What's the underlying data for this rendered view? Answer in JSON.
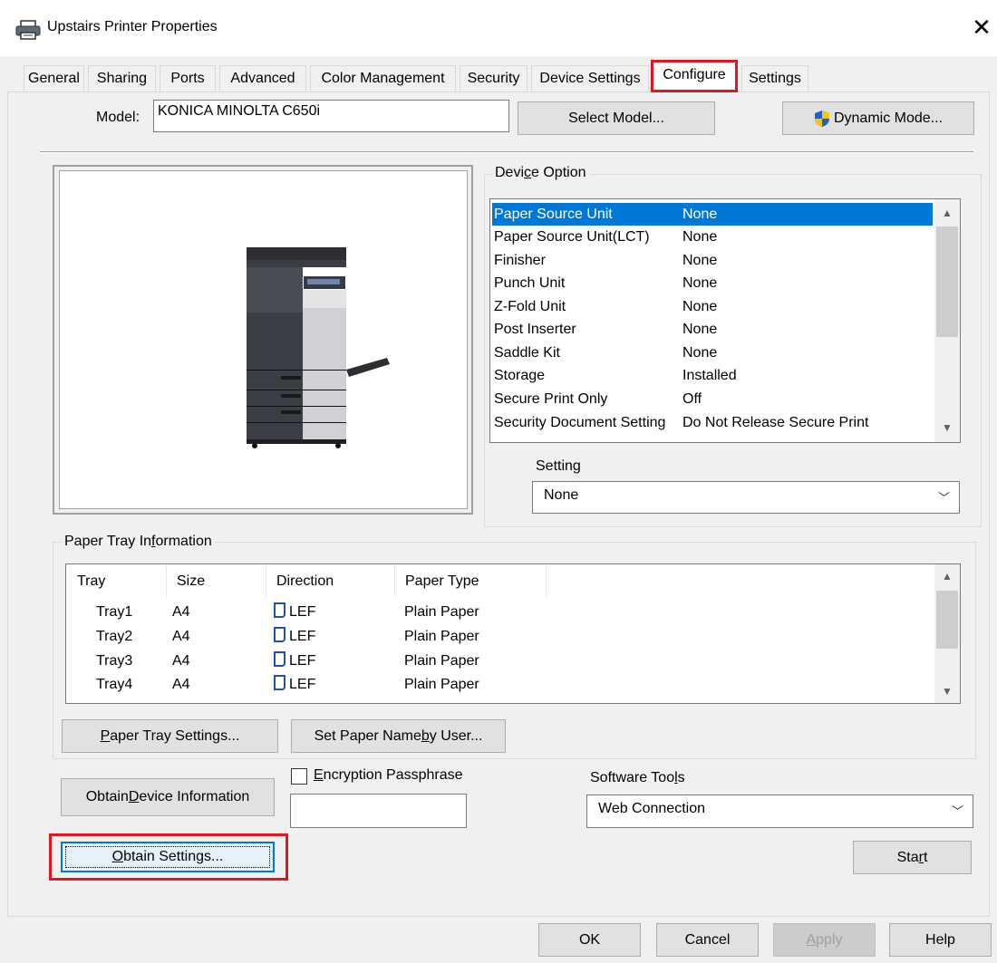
{
  "window": {
    "title": "Upstairs Printer Properties",
    "close": "✕"
  },
  "tabs": [
    "General",
    "Sharing",
    "Ports",
    "Advanced",
    "Color Management",
    "Security",
    "Device Settings",
    "Configure",
    "Settings"
  ],
  "model": {
    "label": "Model:",
    "value": "KONICA MINOLTA C650i",
    "select_button": "Select Model...",
    "dynamic_button": "Dynamic Mode..."
  },
  "device_option": {
    "title_pre": "Devi",
    "title_u": "c",
    "title_post": "e Option",
    "rows": [
      {
        "name": "Paper Source Unit",
        "value": "None"
      },
      {
        "name": "Paper Source Unit(LCT)",
        "value": "None"
      },
      {
        "name": "Finisher",
        "value": "None"
      },
      {
        "name": "Punch Unit",
        "value": "None"
      },
      {
        "name": "Z-Fold Unit",
        "value": "None"
      },
      {
        "name": "Post Inserter",
        "value": "None"
      },
      {
        "name": "Saddle Kit",
        "value": "None"
      },
      {
        "name": "Storage",
        "value": "Installed"
      },
      {
        "name": "Secure Print Only",
        "value": "Off"
      },
      {
        "name": "Security Document Setting",
        "value": "Do Not Release Secure Print"
      }
    ],
    "setting_pre": "Settin",
    "setting_u": "g",
    "setting_post": "",
    "setting_value": "None"
  },
  "paper_tray": {
    "title_pre": "Paper Tray In",
    "title_u": "f",
    "title_post": "ormation",
    "columns": [
      "Tray",
      "Size",
      "Direction",
      "Paper Type"
    ],
    "rows": [
      {
        "tray": "Tray1",
        "size": "A4",
        "direction": "LEF",
        "type": "Plain Paper"
      },
      {
        "tray": "Tray2",
        "size": "A4",
        "direction": "LEF",
        "type": "Plain Paper"
      },
      {
        "tray": "Tray3",
        "size": "A4",
        "direction": "LEF",
        "type": "Plain Paper"
      },
      {
        "tray": "Tray4",
        "size": "A4",
        "direction": "LEF",
        "type": "Plain Paper"
      }
    ],
    "settings_pre": "",
    "settings_u": "P",
    "settings_post": "aper Tray Settings...",
    "setname_pre": "Set Paper Name ",
    "setname_u": "b",
    "setname_post": "y User..."
  },
  "obtain_device": {
    "pre": "Obtain ",
    "u": "D",
    "post": "evice Information"
  },
  "encryption": {
    "pre": "",
    "u": "E",
    "post": "ncryption Passphrase",
    "value": ""
  },
  "software_tools": {
    "pre": "Software Too",
    "u": "l",
    "post": "s",
    "value": "Web Connection"
  },
  "obtain_settings": {
    "pre": "",
    "u": "O",
    "post": "btain Settings..."
  },
  "start": {
    "pre": "Sta",
    "u": "r",
    "post": "t"
  },
  "footer": {
    "ok": "OK",
    "cancel": "Cancel",
    "apply_u": "A",
    "apply_post": "pply",
    "help": "Help"
  },
  "colors": {
    "accent": "#0078d7",
    "highlight": "#e5151f"
  }
}
